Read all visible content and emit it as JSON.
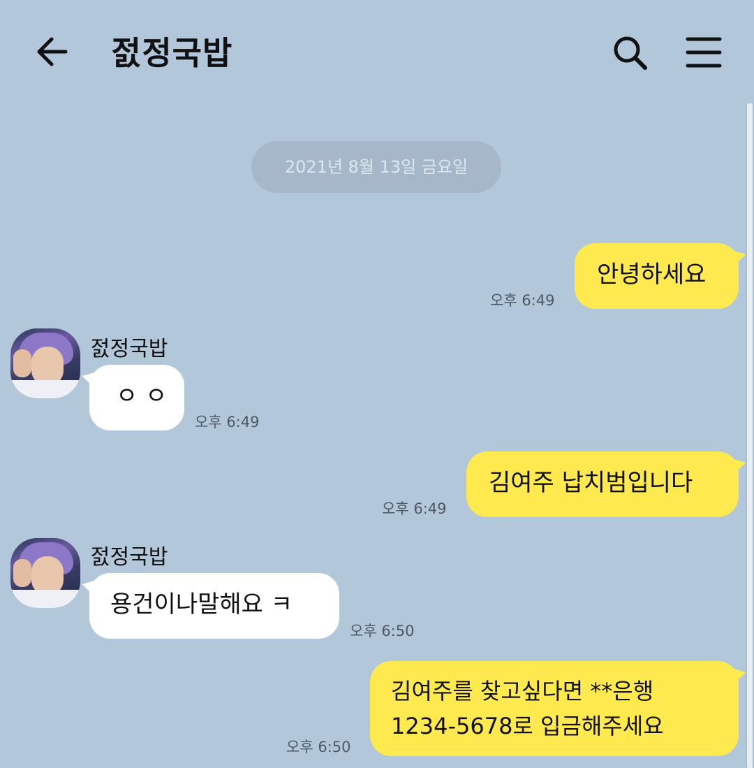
{
  "header": {
    "title": "젌정국밥"
  },
  "date_divider": "2021년 8월 13일 금요일",
  "messages": [
    {
      "from": "me",
      "text": "안녕하세요",
      "time": "오후 6:49"
    },
    {
      "from": "other",
      "sender": "젌정국밥",
      "text": "ㅇ ㅇ",
      "time": "오후 6:49"
    },
    {
      "from": "me",
      "text": "김여주 납치범입니다",
      "time": "오후 6:49"
    },
    {
      "from": "other",
      "sender": "젌정국밥",
      "text": "용건이나말해요 ㅋ",
      "time": "오후 6:50"
    },
    {
      "from": "me",
      "lines": [
        "김여주를 찾고싶다면 **은행",
        "1234-5678로 입금해주세요"
      ],
      "time": "오후 6:50"
    }
  ],
  "colors": {
    "background": "#b2c7da",
    "my_bubble": "#fee94e",
    "other_bubble": "#ffffff",
    "date_pill": "#a5b7c8"
  },
  "icons": [
    "back-arrow-icon",
    "search-icon",
    "menu-icon"
  ]
}
